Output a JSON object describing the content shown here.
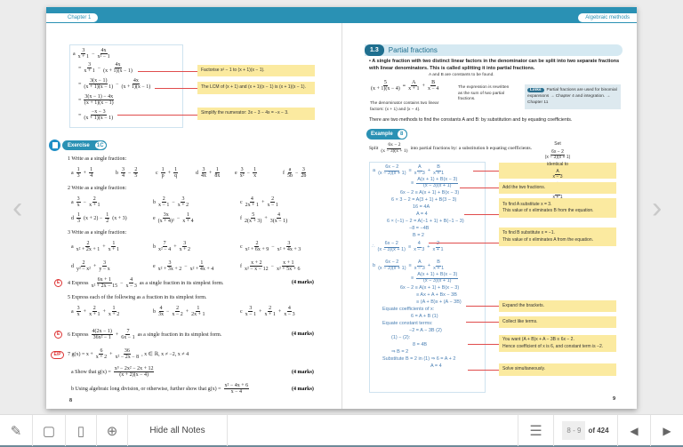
{
  "nav": {
    "prev_arrow": "‹",
    "next_arrow": "›"
  },
  "left": {
    "chapter_tab": "Chapter 1",
    "worked": [
      "a {3|x + 1} − {4x|x² − 1}",
      "= {3|x + 1} − {4x|(x + 1)(x − 1)}",
      "= {3(x − 1)|(x + 1)(x − 1)} − {4x|(x + 1)(x − 1)}",
      "= {3(x − 1) − 4x|(x + 1)(x − 1)}",
      "= {−x − 3|(x + 1)(x − 1)}"
    ],
    "notes": [
      "Factorise x² − 1 to (x + 1)(x − 1).",
      "The LCM of (x + 1) and (x + 1)(x − 1) is (x + 1)(x − 1).",
      "Simplify the numerator: 3x − 3 − 4x = −x − 3."
    ],
    "exercise_label": "Exercise",
    "exercise_num": "1C",
    "q1": "1  Write as a single fraction:",
    "q1_parts": [
      "a  {1|3} + {1|4}",
      "b  {3|4} − {2|5}",
      "c  {1|p} + {1|q}",
      "d  {3|4x} + {1|8x}",
      "e  {3|x²} − {1|x}",
      "f  {a|5b} − {3|2b}"
    ],
    "q2": "2  Write as a single fraction:",
    "q2_parts": [
      "a  {3|x} − {2|x + 1}",
      "b  {2|x − 1} − {3|x + 2}",
      "c  {4|2x + 1} + {2|x − 1}",
      "d  {1|3}(x + 2) − {1|2}(x + 3)",
      "e  {3x|(x + 4)²} − {1|x + 4}",
      "f  {5|2(x + 3)} + {4|3(x − 1)}"
    ],
    "q3": "3  Write as a single fraction:",
    "q3_parts": [
      "a  {2|x² + 2x + 1} + {1|x + 1}",
      "b  {7|x² − 4} + {3|x + 2}",
      "c  {2|x² + 6x + 9} − {3|x² + 4x + 3}",
      "d  {2|y² − x²} + {3|y − x}",
      "e  {3|x² + 3x + 2} − {1|x² + 4x + 4}",
      "f  {x + 2|x² − x − 12} − {x + 1|x² + 5x + 6}"
    ],
    "q4": "4  Express {6x + 1|x² + 2x − 15} − {4|x − 3} as a single fraction in its simplest form.",
    "q5": "5  Express each of the following as a fraction in its simplest form.",
    "q5_parts": [
      "a  {3|x} + {2|x + 1} + {1|x + 2}",
      "b  {4|3x} − {2|x − 2} + {1|2x + 1}",
      "c  {3|x − 1} + {2|x + 1} + {4|x − 3}"
    ],
    "q6": "6  Express {4(2x − 1)|36x² − 1} + {7|6x − 1} as a single fraction in its simplest form.",
    "q7": "7  g(x) = x + {6|x + 2} + {36|x² − 2x − 8}, x ∈ ℝ, x ≠ −2, x ≠ 4",
    "q7a": "a  Show that g(x) = {x³ − 2x² − 2x + 12|(x + 2)(x − 4)}",
    "q7b": "b  Using algebraic long division, or otherwise, further show that g(x) = {x² − 4x + 6|x − 4}",
    "marks": "(4 marks)",
    "icon_e": "E",
    "icon_ep": "E/P",
    "page_number": "8"
  },
  "right": {
    "chapter_tab": "Algebraic methods",
    "section_num": "1.3",
    "section_title": "Partial fractions",
    "bullet": "A single fraction with two distinct linear factors in the denominator can be split into two separate fractions with linear denominators. This is called splitting it into partial fractions.",
    "eq": "{5|(x + 1)(x − 4)} ≡ {A|x + 1} + {B|x − 4}",
    "ab_note": "A and B are constants to be found.",
    "rewrite_note": "The expression is rewritten as the sum of two partial fractions.",
    "denom_note": "The denominator contains two linear factors: (x + 1) and (x − 4).",
    "links_label": "Links",
    "links_text": "Partial fractions are used for binomial expansions → Chapter 4 and integration. → Chapter 11",
    "methods": "There are two methods to find the constants A and B: by substitution and by equating coefficients.",
    "example_label": "Example",
    "example_num": "8",
    "task": "Split {6x − 2|(x − 3)(x + 1)} into partial fractions by:   a  substitution   b  equating coefficients.",
    "sol": [
      "a  {6x − 2|(x − 3)(x + 1)} ≡ {A|x − 3} + {B|x + 1}",
      "≡ {A(x + 1) + B(x − 3)|(x − 3)(x + 1)}",
      "6x − 2 ≡ A(x + 1) + B(x − 3)",
      "6 × 3 − 2 = A(3 + 1) + B(3 − 3)",
      "16 = 4A",
      "A = 4",
      "6 × (−1) − 2 = A(−1 + 1) + B(−1 − 3)",
      "−8 = −4B",
      "B = 2",
      "∴ {6x − 2|(x − 3)(x + 1)} ≡ {4|x − 3} + {2|x + 1}",
      "b  {6x − 2|(x − 3)(x + 1)} ≡ {A|x − 3} + {B|x + 1}",
      "≡ {A(x + 1) + B(x − 3)|(x − 3)(x + 1)}",
      "6x − 2 ≡ A(x + 1) + B(x − 3)",
      "≡ Ax + A + Bx − 3B",
      "≡ (A + B)x + (A − 3B)",
      "Equate coefficients of x:",
      "6 = A + B        (1)",
      "Equate constant terms:",
      "−2 = A − 3B      (2)",
      "(1) − (2):",
      "8 = 4B",
      "⇒      B = 2",
      "Substitute B = 2 in (1) ⇒ 6 = A + 2",
      "A = 4"
    ],
    "notes": [
      "Set {6x − 2|(x − 3)(x + 1)} identical to {A|x − 3} + {B|x + 1}",
      "Add the two fractions.",
      "To find A substitute x = 3.|This value of x eliminates B from the equation.",
      "To find B substitute x = −1.|This value of x eliminates A from the equation.",
      "Expand the brackets.",
      "Collect like terms.",
      "You want (A + B)x + A − 3B ≡ 6x − 2.|Hence coefficient of x is 6, and constant term is −2.",
      "Solve simultaneously."
    ],
    "page_number": "9"
  },
  "toolbar": {
    "hide_notes": "Hide all Notes",
    "page_range": "8 - 9",
    "of_total": "of 424"
  },
  "colors": {
    "brand": "#2a91b4",
    "note": "#fbeaa0",
    "marker": "#e04c4c"
  }
}
